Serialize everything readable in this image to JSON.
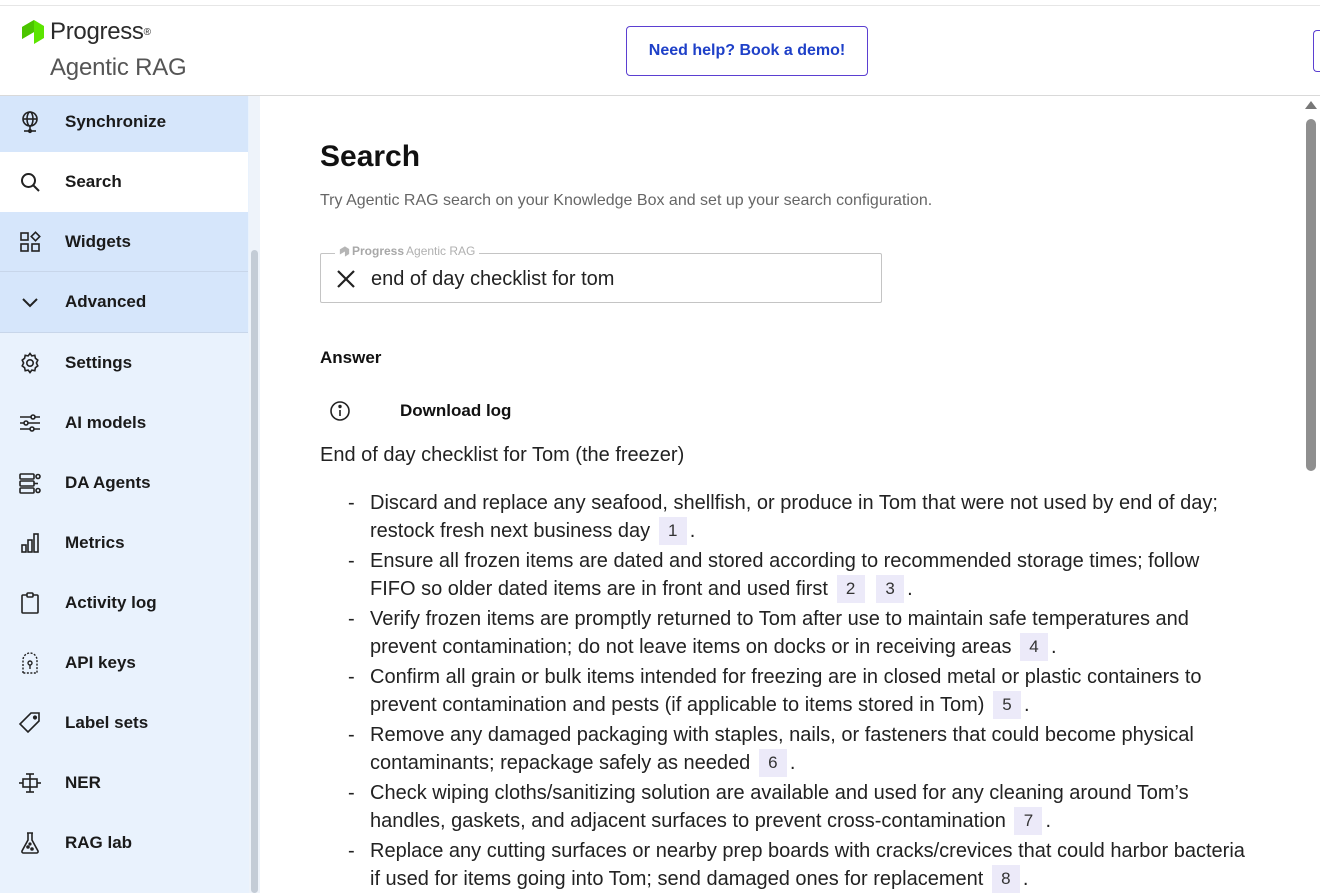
{
  "header": {
    "brand_name": "Progress",
    "brand_reg": "®",
    "brand_sub": "Agentic RAG",
    "demo_button": "Need help? Book a demo!"
  },
  "sidebar": {
    "items": [
      {
        "label": "Synchronize",
        "icon": "globe-network-icon"
      },
      {
        "label": "Search",
        "icon": "search-icon"
      },
      {
        "label": "Widgets",
        "icon": "widgets-icon"
      },
      {
        "label": "Advanced",
        "icon": "chevron-down-icon"
      },
      {
        "label": "Settings",
        "icon": "gear-icon"
      },
      {
        "label": "AI models",
        "icon": "sliders-icon"
      },
      {
        "label": "DA Agents",
        "icon": "agents-icon"
      },
      {
        "label": "Metrics",
        "icon": "bar-chart-icon"
      },
      {
        "label": "Activity log",
        "icon": "clipboard-icon"
      },
      {
        "label": "API keys",
        "icon": "keyhole-icon"
      },
      {
        "label": "Label sets",
        "icon": "tag-icon"
      },
      {
        "label": "NER",
        "icon": "ner-icon"
      },
      {
        "label": "RAG lab",
        "icon": "flask-icon"
      }
    ]
  },
  "main": {
    "title": "Search",
    "subtitle": "Try Agentic RAG search on your Knowledge Box and set up your search configuration.",
    "search": {
      "legend_brand": "Progress",
      "legend_sub": "Agentic RAG",
      "value": "end of day checklist for tom"
    },
    "answer_heading": "Answer",
    "download_log": "Download log",
    "intro": "End of day checklist for Tom (the freezer)",
    "list_marker": "-",
    "items": [
      {
        "text": "Discard and replace any seafood, shellfish, or produce in Tom that were not used by end of day; restock fresh next business day",
        "cites": [
          "1"
        ]
      },
      {
        "text": "Ensure all frozen items are dated and stored according to recommended storage times; follow FIFO so older dated items are in front and used first",
        "cites": [
          "2",
          "3"
        ]
      },
      {
        "text": "Verify frozen items are promptly returned to Tom after use to maintain safe temperatures and prevent contamination; do not leave items on docks or in receiving areas",
        "cites": [
          "4"
        ]
      },
      {
        "text": "Confirm all grain or bulk items intended for freezing are in closed metal or plastic containers to prevent contamination and pests (if applicable to items stored in Tom)",
        "cites": [
          "5"
        ]
      },
      {
        "text": "Remove any damaged packaging with staples, nails, or fasteners that could become physical contaminants; repackage safely as needed",
        "cites": [
          "6"
        ]
      },
      {
        "text": "Check wiping cloths/sanitizing solution are available and used for any cleaning around Tom’s handles, gaskets, and adjacent surfaces to prevent cross-contamination",
        "cites": [
          "7"
        ]
      },
      {
        "text": "Replace any cutting surfaces or nearby prep boards with cracks/crevices that could harbor bacteria if used for items going into Tom; send damaged ones for replacement",
        "cites": [
          "8"
        ]
      }
    ]
  },
  "colors": {
    "accent": "#5b3fd1",
    "link": "#1e40c8",
    "sidebar_bg": "#e9f2fd",
    "sidebar_highlight": "#d6e6fb",
    "brand_green": "#5ce500",
    "cite_bg": "#eceaf9"
  }
}
